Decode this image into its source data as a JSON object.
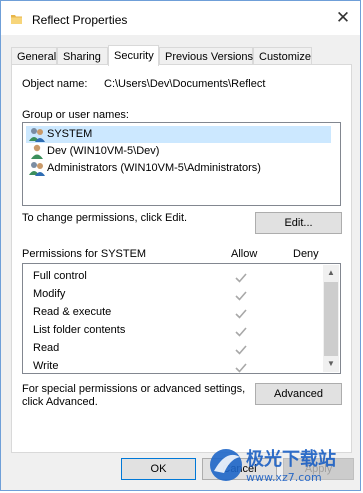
{
  "window": {
    "title": "Reflect Properties",
    "close_glyph": "✕",
    "icon": "folder-icon"
  },
  "tabs": [
    "General",
    "Sharing",
    "Security",
    "Previous Versions",
    "Customize"
  ],
  "active_tab": "Security",
  "security": {
    "object_name_label": "Object name:",
    "object_name_value": "C:\\Users\\Dev\\Documents\\Reflect",
    "group_label": "Group or user names:",
    "users": [
      {
        "name": "SYSTEM",
        "icon": "user-group-icon",
        "selected": true
      },
      {
        "name": "Dev (WIN10VM-5\\Dev)",
        "icon": "user-icon",
        "selected": false
      },
      {
        "name": "Administrators (WIN10VM-5\\Administrators)",
        "icon": "user-group-icon",
        "selected": false
      }
    ],
    "change_text": "To change permissions, click Edit.",
    "edit_button": "Edit...",
    "permissions_label": "Permissions for SYSTEM",
    "allow_header": "Allow",
    "deny_header": "Deny",
    "permissions": [
      {
        "name": "Full control",
        "allow": true,
        "deny": false
      },
      {
        "name": "Modify",
        "allow": true,
        "deny": false
      },
      {
        "name": "Read & execute",
        "allow": true,
        "deny": false
      },
      {
        "name": "List folder contents",
        "allow": true,
        "deny": false
      },
      {
        "name": "Read",
        "allow": true,
        "deny": false
      },
      {
        "name": "Write",
        "allow": true,
        "deny": false
      }
    ],
    "advanced_text_1": "For special permissions or advanced settings,",
    "advanced_text_2": "click Advanced.",
    "advanced_button": "Advanced"
  },
  "footer": {
    "ok": "OK",
    "cancel": "Cancel",
    "apply": "Apply"
  },
  "watermark": {
    "text": "极光下载站",
    "url": "www.xz7.com"
  },
  "colors": {
    "selection": "#cce8ff",
    "window_border": "#6f9fd8",
    "check": "#a8a8a8"
  }
}
